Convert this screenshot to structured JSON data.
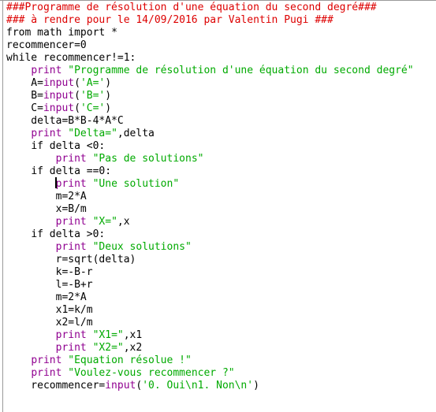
{
  "app": {
    "kind": "python-code-editor",
    "language": "Python 2",
    "background_color": "#ffffff",
    "gutter_color": "#9a9a9a"
  },
  "theme": {
    "plain": "#000000",
    "comment": "#dd0000",
    "keyword": "#ff7700",
    "builtin": "#900090",
    "string": "#00aa00",
    "caret": "#000000"
  },
  "caret": {
    "line_index": 14,
    "column": 8,
    "visible": true
  },
  "code": {
    "lines": [
      {
        "tokens": [
          {
            "t": "comment",
            "s": "###Programme de résolution d'une équation du second degré###"
          }
        ]
      },
      {
        "tokens": [
          {
            "t": "comment",
            "s": "### à rendre pour le 14/09/2016 par Valentin Pugi ###"
          }
        ]
      },
      {
        "tokens": [
          {
            "t": "keyword",
            "s": "from"
          },
          {
            "t": "plain",
            "s": " math "
          },
          {
            "t": "keyword",
            "s": "import"
          },
          {
            "t": "plain",
            "s": " *"
          }
        ]
      },
      {
        "tokens": [
          {
            "t": "plain",
            "s": "recommencer=0"
          }
        ]
      },
      {
        "tokens": [
          {
            "t": "keyword",
            "s": "while"
          },
          {
            "t": "plain",
            "s": " recommencer!=1:"
          }
        ]
      },
      {
        "tokens": [
          {
            "t": "plain",
            "s": "    "
          },
          {
            "t": "builtin",
            "s": "print"
          },
          {
            "t": "plain",
            "s": " "
          },
          {
            "t": "string",
            "s": "\"Programme de résolution d'une équation du second degré\""
          }
        ]
      },
      {
        "tokens": [
          {
            "t": "plain",
            "s": "    A="
          },
          {
            "t": "builtin",
            "s": "input"
          },
          {
            "t": "plain",
            "s": "("
          },
          {
            "t": "string",
            "s": "'A='"
          },
          {
            "t": "plain",
            "s": ")"
          }
        ]
      },
      {
        "tokens": [
          {
            "t": "plain",
            "s": "    B="
          },
          {
            "t": "builtin",
            "s": "input"
          },
          {
            "t": "plain",
            "s": "("
          },
          {
            "t": "string",
            "s": "'B='"
          },
          {
            "t": "plain",
            "s": ")"
          }
        ]
      },
      {
        "tokens": [
          {
            "t": "plain",
            "s": "    C="
          },
          {
            "t": "builtin",
            "s": "input"
          },
          {
            "t": "plain",
            "s": "("
          },
          {
            "t": "string",
            "s": "'C='"
          },
          {
            "t": "plain",
            "s": ")"
          }
        ]
      },
      {
        "tokens": [
          {
            "t": "plain",
            "s": "    delta=B*B-4*A*C"
          }
        ]
      },
      {
        "tokens": [
          {
            "t": "plain",
            "s": "    "
          },
          {
            "t": "builtin",
            "s": "print"
          },
          {
            "t": "plain",
            "s": " "
          },
          {
            "t": "string",
            "s": "\"Delta=\""
          },
          {
            "t": "plain",
            "s": ",delta"
          }
        ]
      },
      {
        "tokens": [
          {
            "t": "plain",
            "s": "    "
          },
          {
            "t": "keyword",
            "s": "if"
          },
          {
            "t": "plain",
            "s": " delta <0:"
          }
        ]
      },
      {
        "tokens": [
          {
            "t": "plain",
            "s": "        "
          },
          {
            "t": "builtin",
            "s": "print"
          },
          {
            "t": "plain",
            "s": " "
          },
          {
            "t": "string",
            "s": "\"Pas de solutions\""
          }
        ]
      },
      {
        "tokens": [
          {
            "t": "plain",
            "s": "    "
          },
          {
            "t": "keyword",
            "s": "if"
          },
          {
            "t": "plain",
            "s": " delta ==0:"
          }
        ]
      },
      {
        "tokens": [
          {
            "t": "plain",
            "s": "        "
          },
          {
            "t": "builtin",
            "s": "print"
          },
          {
            "t": "plain",
            "s": " "
          },
          {
            "t": "string",
            "s": "\"Une solution\""
          }
        ]
      },
      {
        "tokens": [
          {
            "t": "plain",
            "s": "        m=2*A"
          }
        ]
      },
      {
        "tokens": [
          {
            "t": "plain",
            "s": "        x=B/m"
          }
        ]
      },
      {
        "tokens": [
          {
            "t": "plain",
            "s": "        "
          },
          {
            "t": "builtin",
            "s": "print"
          },
          {
            "t": "plain",
            "s": " "
          },
          {
            "t": "string",
            "s": "\"X=\""
          },
          {
            "t": "plain",
            "s": ",x"
          }
        ]
      },
      {
        "tokens": [
          {
            "t": "plain",
            "s": "    "
          },
          {
            "t": "keyword",
            "s": "if"
          },
          {
            "t": "plain",
            "s": " delta >0:"
          }
        ]
      },
      {
        "tokens": [
          {
            "t": "plain",
            "s": "        "
          },
          {
            "t": "builtin",
            "s": "print"
          },
          {
            "t": "plain",
            "s": " "
          },
          {
            "t": "string",
            "s": "\"Deux solutions\""
          }
        ]
      },
      {
        "tokens": [
          {
            "t": "plain",
            "s": "        r=sqrt(delta)"
          }
        ]
      },
      {
        "tokens": [
          {
            "t": "plain",
            "s": "        k=-B-r"
          }
        ]
      },
      {
        "tokens": [
          {
            "t": "plain",
            "s": "        l=-B+r"
          }
        ]
      },
      {
        "tokens": [
          {
            "t": "plain",
            "s": "        m=2*A"
          }
        ]
      },
      {
        "tokens": [
          {
            "t": "plain",
            "s": "        x1=k/m"
          }
        ]
      },
      {
        "tokens": [
          {
            "t": "plain",
            "s": "        x2=l/m"
          }
        ]
      },
      {
        "tokens": [
          {
            "t": "plain",
            "s": "        "
          },
          {
            "t": "builtin",
            "s": "print"
          },
          {
            "t": "plain",
            "s": " "
          },
          {
            "t": "string",
            "s": "\"X1=\""
          },
          {
            "t": "plain",
            "s": ",x1"
          }
        ]
      },
      {
        "tokens": [
          {
            "t": "plain",
            "s": "        "
          },
          {
            "t": "builtin",
            "s": "print"
          },
          {
            "t": "plain",
            "s": " "
          },
          {
            "t": "string",
            "s": "\"X2=\""
          },
          {
            "t": "plain",
            "s": ",x2"
          }
        ]
      },
      {
        "tokens": [
          {
            "t": "plain",
            "s": "    "
          },
          {
            "t": "builtin",
            "s": "print"
          },
          {
            "t": "plain",
            "s": " "
          },
          {
            "t": "string",
            "s": "\"Equation résolue !\""
          }
        ]
      },
      {
        "tokens": [
          {
            "t": "plain",
            "s": "    "
          },
          {
            "t": "builtin",
            "s": "print"
          },
          {
            "t": "plain",
            "s": " "
          },
          {
            "t": "string",
            "s": "\"Voulez-vous recommencer ?\""
          }
        ]
      },
      {
        "tokens": [
          {
            "t": "plain",
            "s": "    recommencer="
          },
          {
            "t": "builtin",
            "s": "input"
          },
          {
            "t": "plain",
            "s": "("
          },
          {
            "t": "string",
            "s": "'0. Oui\\n1. Non\\n'"
          },
          {
            "t": "plain",
            "s": ")"
          }
        ]
      }
    ]
  }
}
